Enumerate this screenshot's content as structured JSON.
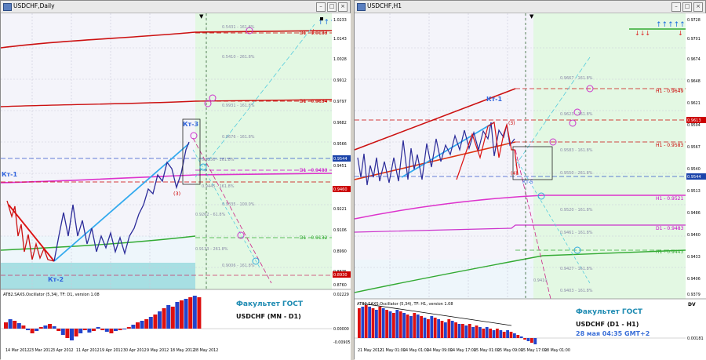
{
  "left": {
    "title": "USDCHF,Daily",
    "wave_labels": {
      "kt1": "Кт-1",
      "kt2": "Кт-2",
      "kt3": "Кт-3",
      "p3": "(3)"
    },
    "levels": [
      {
        "label": "D1 - 1.0183",
        "value": "1.0183",
        "color": "#cc0000"
      },
      {
        "label": "D1 - 0.9834",
        "value": "0.9834",
        "color": "#cc0000"
      },
      {
        "label": "D1 - 0.9483",
        "value": "0.9483",
        "color": "#cc00cc"
      },
      {
        "label": "D1 - 0.9132",
        "value": "0.9132",
        "color": "#33aa33"
      }
    ],
    "fibo": [
      "0.5431 - 161.8%",
      "0.5410 - 261.8%",
      "0.9931 - 161.8%",
      "0.9676 - 161.8%",
      "0.9550 - 161.8%",
      "0.9445 - 161.8%",
      "0.9335 - 100.0%",
      "0.9262 - 61.8%",
      "0.9133 - 261.8%",
      "0.9006 - 161.8%"
    ],
    "price_axis": [
      "1.0233",
      "1.0143",
      "1.0028",
      "0.9912",
      "0.9797",
      "0.9682",
      "0.9566",
      "0.9451",
      "0.9336",
      "0.9221",
      "0.9106",
      "0.8990",
      "0.8875",
      "0.8760"
    ],
    "price_badges": [
      {
        "text": "0.9544",
        "color": "#1b44aa"
      },
      {
        "text": "0.9460",
        "color": "#cc0000"
      },
      {
        "text": "0.8930",
        "color": "#cc0000"
      }
    ],
    "osc_label": "ATB2.SAXS.Oscillator (5,34), TF: D1, version 1.08",
    "osc_axis": [
      "0.02229",
      "0.00000",
      "-0.00905"
    ],
    "dates": [
      "14 Mar 2012",
      "23 Mar 2012",
      "3 Apr 2012",
      "11 Apr 2012",
      "19 Apr 2012",
      "30 Apr 2012",
      "9 May 2012",
      "18 May 2012",
      "28 May 2012"
    ],
    "caption1": "Факультет ГОСТ",
    "caption2": "USDCHF (MN - D1)"
  },
  "right": {
    "title": "USDCHF,H1",
    "wave_labels": {
      "kt1": "Кт-1",
      "p3": "(3)",
      "p4": "(4)",
      "p5": "Кт-5"
    },
    "levels": [
      {
        "label": "H1 - 0.9649",
        "value": "0.9649",
        "color": "#cc0000"
      },
      {
        "label": "H1 - 0.9583",
        "value": "0.9583",
        "color": "#cc0000"
      },
      {
        "label": "H1 - 0.9521",
        "value": "0.9521",
        "color": "#cc00cc"
      },
      {
        "label": "D1 - 0.9483",
        "value": "0.9483",
        "color": "#cc00cc"
      },
      {
        "label": "H1 - 0.9443",
        "value": "0.9443",
        "color": "#33aa33"
      }
    ],
    "fibo": [
      "0.9667 - 161.8%",
      "0.9623 - 161.8%",
      "0.9583 - 161.8%",
      "0.9550 - 261.8%",
      "0.9520 - 161.8%",
      "0.9461 - 161.8%",
      "0.9427 - 161.8%",
      "0.9410",
      "0.9403 - 161.8%"
    ],
    "price_axis": [
      "0.9728",
      "0.9701",
      "0.9674",
      "0.9648",
      "0.9621",
      "0.9594",
      "0.9567",
      "0.9540",
      "0.9513",
      "0.9486",
      "0.9460",
      "0.9433",
      "0.9406",
      "0.9379"
    ],
    "price_badges": [
      {
        "text": "0.9613",
        "color": "#cc0000"
      },
      {
        "text": "0.9544",
        "color": "#1b44aa"
      }
    ],
    "osc_label": "ATB2.SAXS.Oscillator (5,34), TF: H1, version 1.08",
    "osc_axis": [
      "DV",
      "0.00181"
    ],
    "dates": [
      "21 May 2012",
      "21 May 01:00",
      "24 May 01:00",
      "24 May 09:00",
      "24 May 17:00",
      "25 May 01:00",
      "25 May 09:00",
      "25 May 17:00",
      "28 May 01:00"
    ],
    "caption1": "Факультет ГОСТ",
    "caption2": "USDCHF (D1 - H1)",
    "caption3": "28 мая 04:35 GMT+2"
  }
}
